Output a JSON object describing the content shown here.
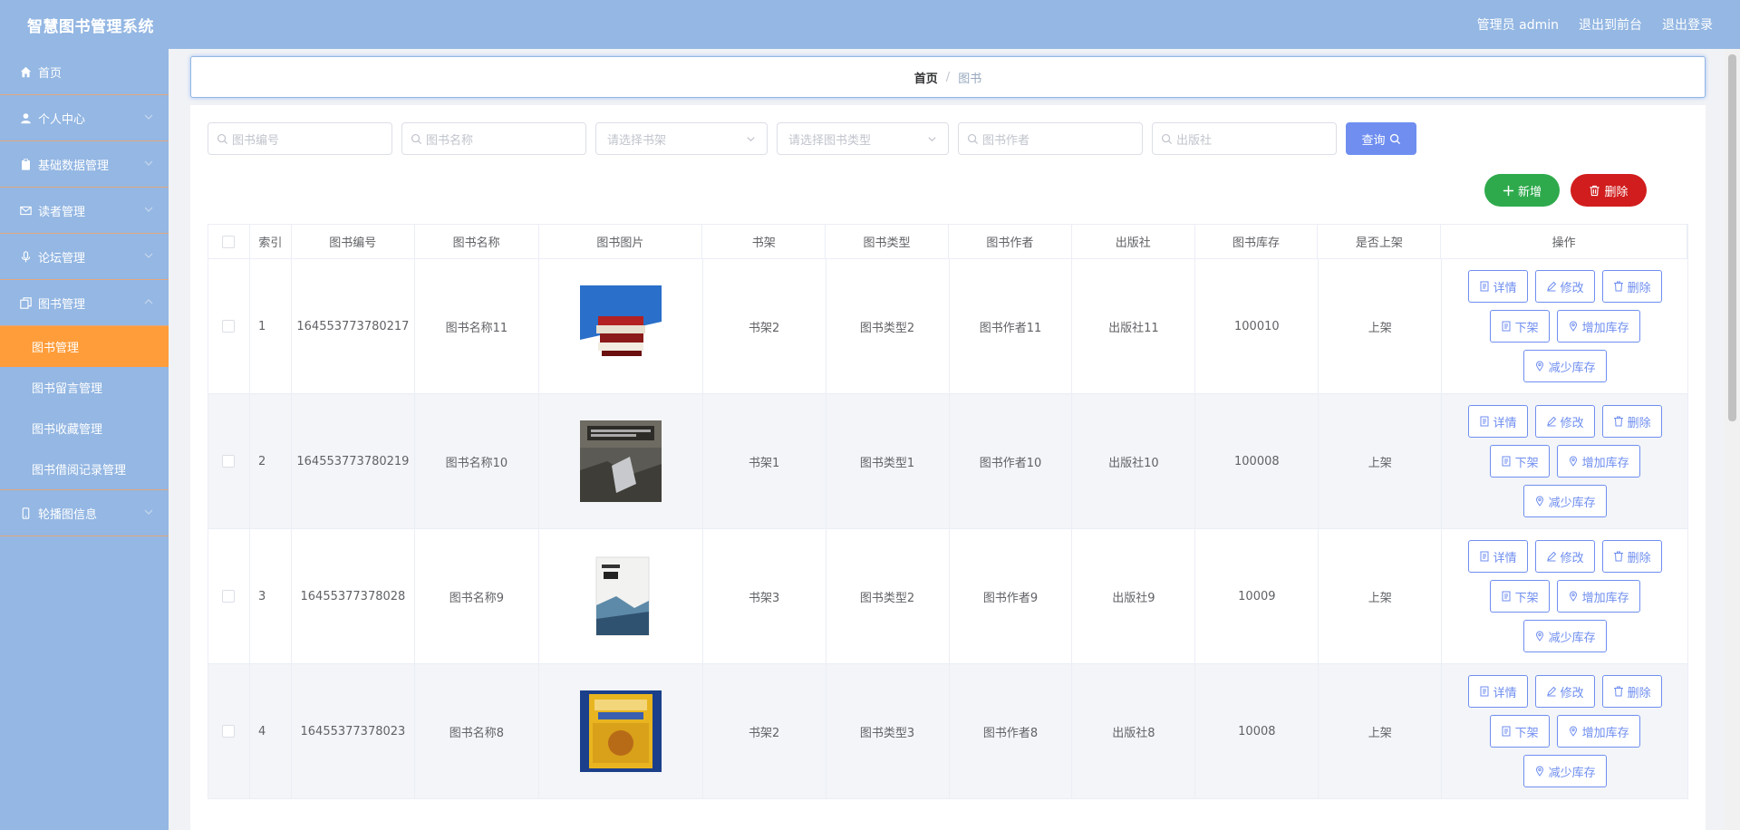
{
  "header": {
    "brand": "智慧图书管理系统",
    "links": [
      "管理员 admin",
      "退出到前台",
      "退出登录"
    ]
  },
  "sidebar": {
    "items": [
      {
        "label": "首页",
        "icon": "home-icon"
      },
      {
        "label": "个人中心",
        "icon": "user-icon"
      },
      {
        "label": "基础数据管理",
        "icon": "clipboard-icon"
      },
      {
        "label": "读者管理",
        "icon": "mail-icon"
      },
      {
        "label": "论坛管理",
        "icon": "microphone-icon"
      },
      {
        "label": "图书管理",
        "icon": "copy-icon"
      }
    ],
    "book_sub": [
      "图书管理",
      "图书留言管理",
      "图书收藏管理",
      "图书借阅记录管理"
    ],
    "last_item": {
      "label": "轮播图信息",
      "icon": "mobile-icon"
    }
  },
  "breadcrumb": {
    "home": "首页",
    "sep": "/",
    "current": "图书"
  },
  "search": {
    "fields": [
      {
        "placeholder": "图书编号",
        "type": "input"
      },
      {
        "placeholder": "图书名称",
        "type": "input"
      },
      {
        "placeholder": "请选择书架",
        "type": "select"
      },
      {
        "placeholder": "请选择图书类型",
        "type": "select"
      },
      {
        "placeholder": "图书作者",
        "type": "input"
      },
      {
        "placeholder": "出版社",
        "type": "input"
      }
    ],
    "query_label": "查询"
  },
  "actions": {
    "add_label": "新增",
    "delete_label": "删除"
  },
  "table": {
    "headers": [
      "",
      "索引",
      "图书编号",
      "图书名称",
      "图书图片",
      "书架",
      "图书类型",
      "图书作者",
      "出版社",
      "图书库存",
      "是否上架",
      "操作"
    ],
    "rows": [
      {
        "index": "1",
        "code": "164553773780217",
        "name": "图书名称11",
        "cover": "blue-books",
        "shelf": "书架2",
        "type": "图书类型2",
        "author": "图书作者11",
        "publisher": "出版社11",
        "stock": "100010",
        "status": "上架"
      },
      {
        "index": "2",
        "code": "164553773780219",
        "name": "图书名称10",
        "cover": "dark-photo",
        "shelf": "书架1",
        "type": "图书类型1",
        "author": "图书作者10",
        "publisher": "出版社10",
        "stock": "100008",
        "status": "上架"
      },
      {
        "index": "3",
        "code": "16455377378028",
        "name": "图书名称9",
        "cover": "white-book",
        "shelf": "书架3",
        "type": "图书类型2",
        "author": "图书作者9",
        "publisher": "出版社9",
        "stock": "10009",
        "status": "上架"
      },
      {
        "index": "4",
        "code": "16455377378023",
        "name": "图书名称8",
        "cover": "blue-yellow",
        "shelf": "书架2",
        "type": "图书类型3",
        "author": "图书作者8",
        "publisher": "出版社8",
        "stock": "10008",
        "status": "上架"
      }
    ],
    "ops": {
      "detail": "详情",
      "edit": "修改",
      "delete": "删除",
      "offshelf": "下架",
      "add_stock": "增加库存",
      "reduce_stock": "减少库存"
    }
  },
  "colors": {
    "header_bg": "#94b7e3",
    "active_menu": "#ff9d3a",
    "primary": "#6f8ef0",
    "success": "#2eaa4c",
    "danger": "#d11d1d"
  }
}
